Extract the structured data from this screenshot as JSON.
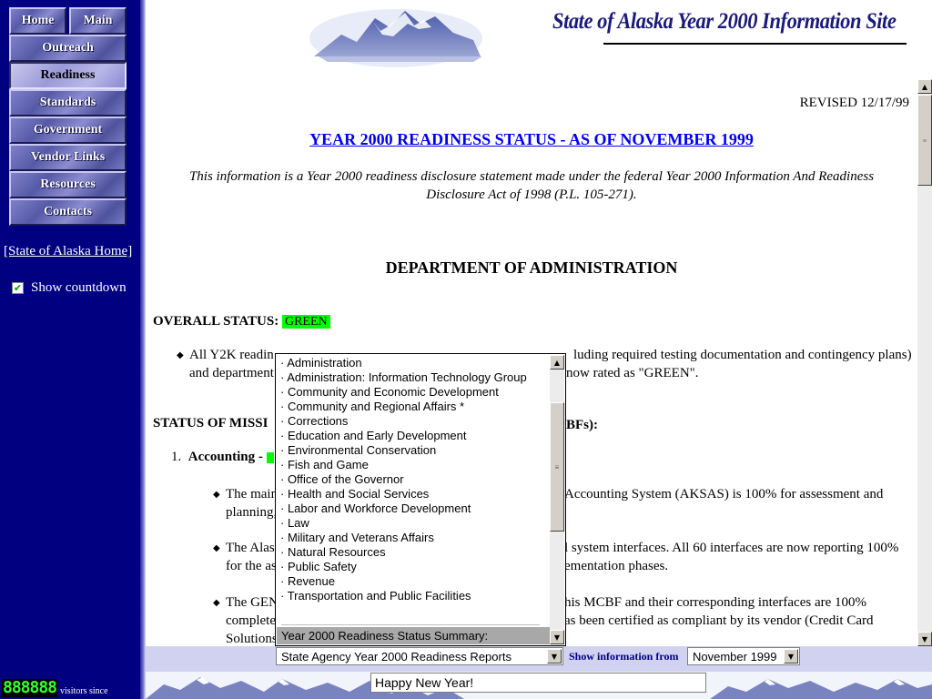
{
  "nav": {
    "buttons": [
      "Home",
      "Main",
      "Outreach",
      "Readiness",
      "Standards",
      "Government",
      "Vendor Links",
      "Resources",
      "Contacts"
    ],
    "active": "Readiness",
    "home_link": "[State of Alaska Home]",
    "countdown_label": "Show countdown",
    "countdown_checked": true,
    "counter_digits": "888888",
    "counter_label": "visitors since"
  },
  "banner": {
    "title": "State of Alaska Year 2000 Information Site"
  },
  "content": {
    "revised": "REVISED 12/17/99",
    "title": "YEAR 2000 READINESS STATUS - AS OF NOVEMBER 1999",
    "disclaimer": "This information is a Year 2000 readiness disclosure statement made under the federal Year 2000 Information And Readiness Disclosure Act of 1998 (P.L. 105-271).",
    "department_heading": "DEPARTMENT OF ADMINISTRATION",
    "overall_status_label": "OVERALL STATUS:",
    "overall_status_value": "GREEN",
    "overall_bullet_start": "All Y2K readin",
    "overall_bullet_end": "luding required testing documentation and contingency plans)",
    "overall_bullet_line2_start": "and department",
    "overall_bullet_line2_end": "now rated as \"GREEN\".",
    "mission_heading_start": "STATUS OF MISSI",
    "mission_heading_end": "BFs):",
    "item1_number": "1.",
    "item1_label": "Accounting -",
    "sub_bullets": [
      {
        "line1_start": "The main",
        "line1_end": "Accounting System (AKSAS) is 100% for assessment and",
        "line2_start": "planning,",
        "line2_end": ""
      },
      {
        "line1_start": "The Alas",
        "line1_end": "l system interfaces. All 60 interfaces are now reporting 100%",
        "line2_start": "for the as",
        "line2_end": "ementation phases."
      },
      {
        "line1_start": "The GEN",
        "line1_end": "his MCBF and their corresponding interfaces are 100%",
        "line2_start": "complete",
        "line2_end": "as been certified as compliant by its vendor (Credit Card",
        "line3_start": "Solutions"
      }
    ]
  },
  "dropdown": {
    "items": [
      "· Administration",
      "· Administration: Information Technology Group",
      "· Community and Economic Development",
      "· Community and Regional Affairs *",
      "· Corrections",
      "· Education and Early Development",
      "· Environmental Conservation",
      "· Fish and Game",
      "· Office of the Governor",
      "· Health and Social Services",
      "· Labor and Workforce Development",
      "· Law",
      "· Military and Veterans Affairs",
      "· Natural Resources",
      "· Public Safety",
      "· Revenue",
      "· Transportation and Public Facilities"
    ],
    "highlighted": "Year 2000 Readiness Status Summary:"
  },
  "controls": {
    "report_select_value": "State Agency Year 2000 Readiness Reports",
    "show_from_label": "Show information from",
    "month_select_value": "November 1999",
    "message_value": "Happy New Year!"
  },
  "colors": {
    "nav_background": "#000080",
    "status_green": "#00ff00",
    "link_blue": "#0000ee",
    "bottom_bar": "#d0d2f0"
  },
  "icons": [
    "checkbox-check-icon",
    "scroll-up-arrow-icon",
    "scroll-down-arrow-icon",
    "dropdown-arrow-icon",
    "bullet-icon",
    "mountain-logo-icon"
  ]
}
